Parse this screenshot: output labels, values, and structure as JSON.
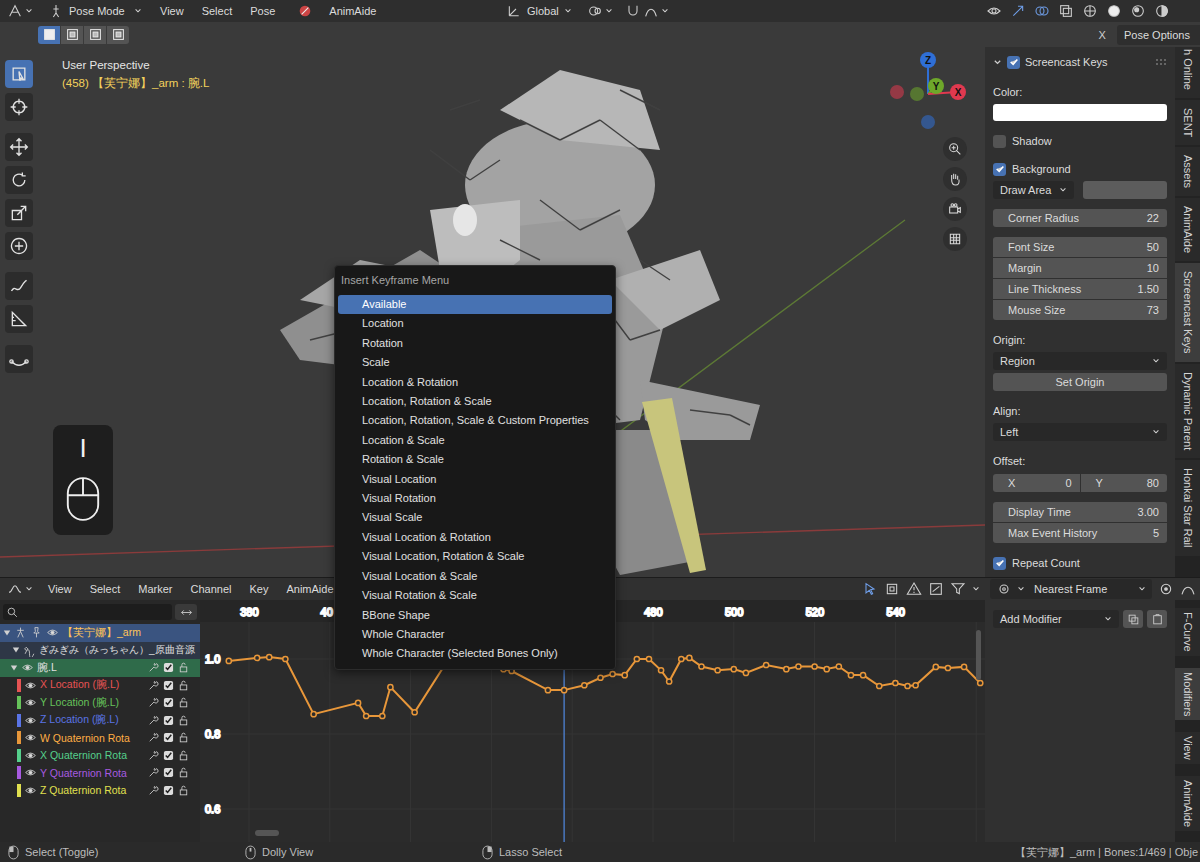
{
  "header": {
    "mode": "Pose Mode",
    "menus": [
      "View",
      "Select",
      "Pose",
      "AnimAide"
    ],
    "orientation": "Global",
    "close": "X",
    "pose_options": "Pose Options"
  },
  "select_modes": [
    {
      "selected": true
    },
    {
      "selected": false
    },
    {
      "selected": false
    },
    {
      "selected": false
    }
  ],
  "tools": [
    {
      "selected": true
    },
    {
      "selected": false
    },
    {
      "selected": false
    },
    {
      "selected": false
    },
    {
      "selected": false
    },
    {
      "selected": false
    },
    {
      "selected": false
    },
    {
      "selected": false
    },
    {
      "selected": false
    }
  ],
  "viewport": {
    "title": "User Perspective",
    "info": "(458) 【芙宁娜】_arm : 腕.L",
    "axes": [
      {
        "label": "Z",
        "color": "#2f6fd6"
      },
      {
        "label": "Y",
        "color": "#6ea82a"
      },
      {
        "label": "X",
        "color": "#e0394f"
      }
    ],
    "key": "I"
  },
  "sidebar": {
    "panel": {
      "title": "Screencast Keys",
      "checked": true,
      "expanded": true
    },
    "rows": [
      {
        "kind": "label",
        "label": "Color:"
      },
      {
        "kind": "swatch",
        "color": "#ffffff"
      },
      {
        "kind": "check",
        "label": "Shadow",
        "checked": false
      },
      {
        "kind": "check",
        "label": "Background",
        "checked": true
      },
      {
        "kind": "select-swatch",
        "value": "Draw Area",
        "color": "#5c5c5c"
      },
      {
        "kind": "numbers",
        "fields": [
          {
            "label": "Corner Radius",
            "value": "22"
          }
        ]
      },
      {
        "kind": "numbers",
        "fields": [
          {
            "label": "Font Size",
            "value": "50"
          },
          {
            "label": "Margin",
            "value": "10"
          },
          {
            "label": "Line Thickness",
            "value": "1.50"
          },
          {
            "label": "Mouse Size",
            "value": "73"
          }
        ]
      },
      {
        "kind": "label",
        "label": "Origin:"
      },
      {
        "kind": "select",
        "value": "Region"
      },
      {
        "kind": "button",
        "label": "Set Origin"
      },
      {
        "kind": "label",
        "label": "Align:"
      },
      {
        "kind": "select",
        "value": "Left"
      },
      {
        "kind": "label",
        "label": "Offset:"
      },
      {
        "kind": "pair",
        "fields": [
          {
            "label": "X",
            "value": "0"
          },
          {
            "label": "Y",
            "value": "80"
          }
        ]
      },
      {
        "kind": "numbers",
        "fields": [
          {
            "label": "Display Time",
            "value": "3.00"
          },
          {
            "label": "Max Event History",
            "value": "5"
          }
        ]
      },
      {
        "kind": "check",
        "label": "Repeat Count",
        "checked": true
      }
    ]
  },
  "tabs": [
    {
      "label": "h Online",
      "selected": false
    },
    {
      "label": "SENT",
      "selected": false
    },
    {
      "label": "Assets",
      "selected": false
    },
    {
      "label": "AnimAide",
      "selected": false
    },
    {
      "label": "Screencast Keys",
      "selected": true
    },
    {
      "label": "Dynamic Parent",
      "selected": false
    },
    {
      "label": "Honkai Star Rail",
      "selected": false
    }
  ],
  "menu": {
    "title": "Insert Keyframe Menu",
    "items": [
      {
        "label": "Available",
        "selected": true
      },
      {
        "label": "Location",
        "selected": false
      },
      {
        "label": "Rotation",
        "selected": false
      },
      {
        "label": "Scale",
        "selected": false
      },
      {
        "label": "Location & Rotation",
        "selected": false
      },
      {
        "label": "Location, Rotation & Scale",
        "selected": false
      },
      {
        "label": "Location, Rotation, Scale & Custom Properties",
        "selected": false
      },
      {
        "label": "Location & Scale",
        "selected": false
      },
      {
        "label": "Rotation & Scale",
        "selected": false
      },
      {
        "label": "Visual Location",
        "selected": false
      },
      {
        "label": "Visual Rotation",
        "selected": false
      },
      {
        "label": "Visual Scale",
        "selected": false
      },
      {
        "label": "Visual Location & Rotation",
        "selected": false
      },
      {
        "label": "Visual Location, Rotation & Scale",
        "selected": false
      },
      {
        "label": "Visual Location & Scale",
        "selected": false
      },
      {
        "label": "Visual Rotation & Scale",
        "selected": false
      },
      {
        "label": "BBone Shape",
        "selected": false
      },
      {
        "label": "Whole Character",
        "selected": false
      },
      {
        "label": "Whole Character (Selected Bones Only)",
        "selected": false
      }
    ]
  },
  "graph": {
    "menus": [
      "View",
      "Select",
      "Marker",
      "Channel",
      "Key",
      "AnimAide"
    ],
    "snap": "Nearest Frame",
    "x_ticks": [
      {
        "frame": 380,
        "label": "380"
      },
      {
        "frame": 400,
        "label": "40"
      },
      {
        "frame": 480,
        "label": "480"
      },
      {
        "frame": 500,
        "label": "500"
      },
      {
        "frame": 520,
        "label": "520"
      },
      {
        "frame": 540,
        "label": "540"
      }
    ],
    "y_ticks": [
      {
        "value": 1.0,
        "label": "1.0"
      },
      {
        "value": 0.8,
        "label": "0.8"
      },
      {
        "value": 0.6,
        "label": "0.6"
      }
    ],
    "current_frame": 458,
    "series": [
      {
        "color": "#e8973a",
        "frames": [
          375,
          382,
          385,
          389,
          396,
          407,
          409,
          413,
          415,
          421,
          430,
          437,
          443,
          445,
          454,
          458,
          463,
          467,
          470,
          473,
          476,
          479,
          482,
          484,
          487,
          489,
          492,
          496,
          500,
          503,
          508,
          513,
          516,
          520,
          523,
          526,
          529,
          532,
          536,
          540,
          543,
          545,
          550,
          553,
          557,
          561
        ],
        "values": [
          0.995,
          1.003,
          1.005,
          1.0,
          0.853,
          0.883,
          0.848,
          0.848,
          0.925,
          0.858,
          1.01,
          0.985,
          0.973,
          0.968,
          0.917,
          0.917,
          0.93,
          0.95,
          0.96,
          0.957,
          1.0,
          1.0,
          0.97,
          0.94,
          1.0,
          1.003,
          0.98,
          0.97,
          0.973,
          0.963,
          0.984,
          0.973,
          0.98,
          0.98,
          0.973,
          0.98,
          0.957,
          0.957,
          0.928,
          0.936,
          0.928,
          0.93,
          0.979,
          0.976,
          0.979,
          0.936
        ]
      }
    ],
    "channels": [
      {
        "kind": "object",
        "label": "【芙宁娜】_arm",
        "expanded": true,
        "selected": true,
        "visible": true
      },
      {
        "kind": "action",
        "label": "ぎみぎみ（みっちゃん）_原曲音源",
        "expanded": true,
        "selected": false
      },
      {
        "kind": "group",
        "label": "腕.L",
        "expanded": true,
        "selected": true,
        "visible": true,
        "enabled": true,
        "locked": false
      },
      {
        "kind": "fcurve",
        "label": "X Location (腕.L)",
        "color": "#e65353",
        "selected": false,
        "visible": true,
        "enabled": true,
        "locked": false
      },
      {
        "kind": "fcurve",
        "label": "Y Location (腕.L)",
        "color": "#66c25a",
        "selected": false,
        "visible": true,
        "enabled": true,
        "locked": false
      },
      {
        "kind": "fcurve",
        "label": "Z Location (腕.L)",
        "color": "#5a74e6",
        "selected": false,
        "visible": true,
        "enabled": true,
        "locked": false
      },
      {
        "kind": "fcurve",
        "label": "W Quaternion Rota",
        "color": "#e8973a",
        "selected": true,
        "visible": true,
        "enabled": true,
        "locked": false
      },
      {
        "kind": "fcurve",
        "label": "X Quaternion Rota",
        "color": "#55d08c",
        "selected": false,
        "visible": true,
        "enabled": true,
        "locked": false
      },
      {
        "kind": "fcurve",
        "label": "Y Quaternion Rota",
        "color": "#a75ae0",
        "selected": false,
        "visible": true,
        "enabled": true,
        "locked": false
      },
      {
        "kind": "fcurve",
        "label": "Z Quaternion Rota",
        "color": "#e0e04f",
        "selected": false,
        "visible": true,
        "enabled": true,
        "locked": false
      }
    ],
    "add_modifier": "Add Modifier",
    "tabs": [
      {
        "label": "F-Curve",
        "selected": false
      },
      {
        "label": "Modifiers",
        "selected": true
      },
      {
        "label": "View",
        "selected": false
      },
      {
        "label": "AnimAide",
        "selected": false
      }
    ]
  },
  "status_bar": {
    "items": [
      "Select (Toggle)",
      "Dolly View",
      "Lasso Select"
    ],
    "info": "【芙宁娜】_arm | Bones:1/469 | Obje"
  }
}
